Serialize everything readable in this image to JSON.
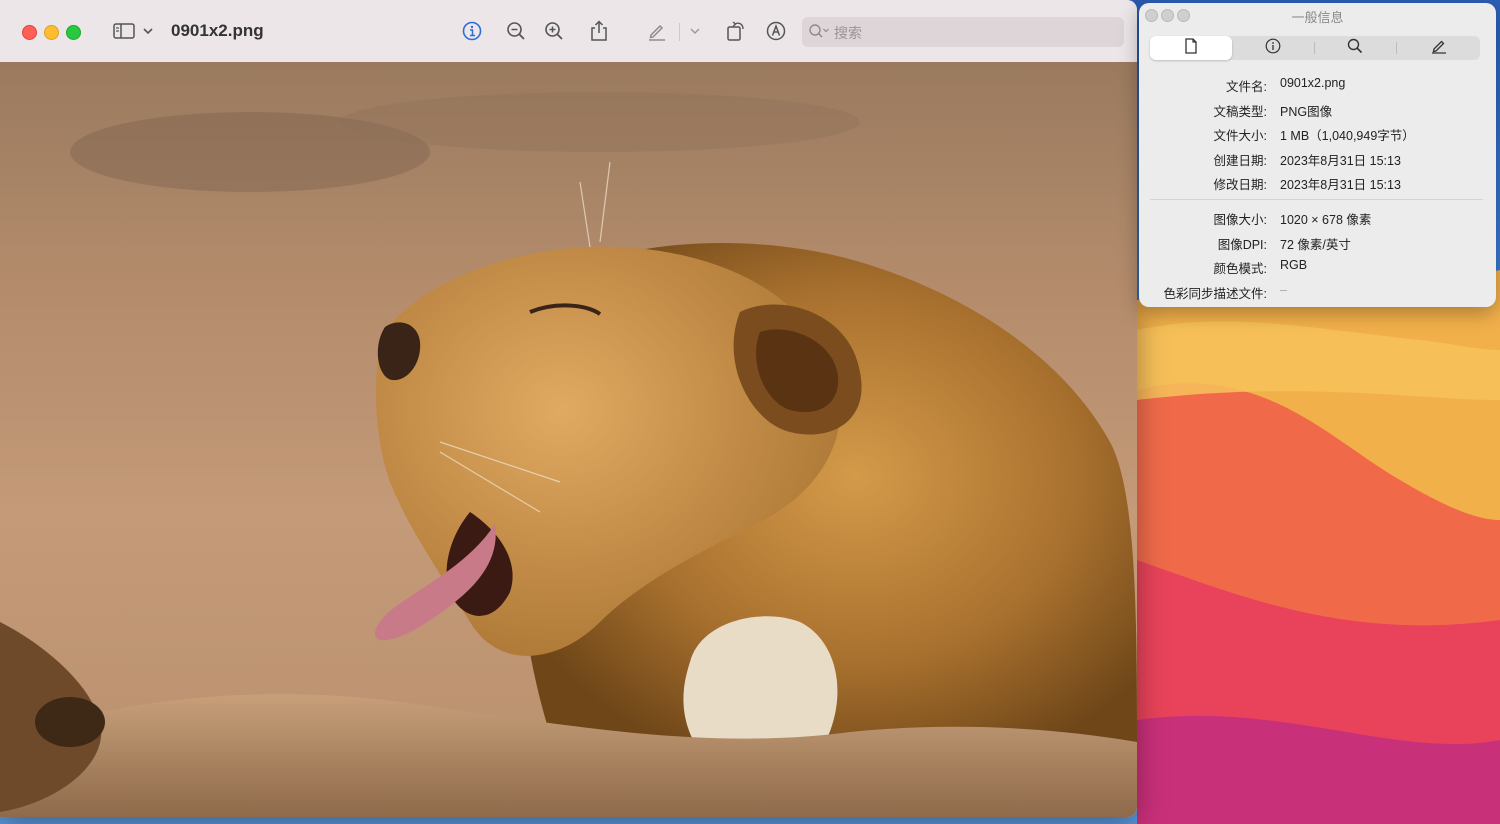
{
  "preview": {
    "document_title": "0901x2.png",
    "search": {
      "placeholder": "搜索",
      "value": ""
    },
    "toolbar_icons": [
      "sidebar-toggle-icon",
      "chevron-down-icon",
      "info-icon",
      "zoom-out-icon",
      "zoom-in-icon",
      "share-icon",
      "markup-pen-icon",
      "chevron-down-icon",
      "rotate-icon",
      "annotate-icon",
      "search-icon"
    ]
  },
  "info_panel": {
    "title": "一般信息",
    "tabs": [
      {
        "name": "document-icon",
        "active": true
      },
      {
        "name": "info-icon",
        "active": false
      },
      {
        "name": "search-icon",
        "active": false
      },
      {
        "name": "pen-icon",
        "active": false
      }
    ],
    "rows": [
      {
        "label": "文件名:",
        "value": "0901x2.png"
      },
      {
        "label": "文稿类型:",
        "value": "PNG图像"
      },
      {
        "label": "文件大小:",
        "value": "1 MB（1,040,949字节）"
      },
      {
        "label": "创建日期:",
        "value": "2023年8月31日 15:13"
      },
      {
        "label": "修改日期:",
        "value": "2023年8月31日 15:13"
      },
      {
        "label": "图像大小:",
        "value": "1020 × 678 像素"
      },
      {
        "label": "图像DPI:",
        "value": "72 像素/英寸"
      },
      {
        "label": "颜色模式:",
        "value": "RGB"
      },
      {
        "label": "色彩同步描述文件:",
        "value": "–"
      }
    ]
  },
  "colors": {
    "traffic_close": "#fe5f57",
    "traffic_minimize": "#febc2e",
    "traffic_maximize": "#28c840",
    "info_accent": "#2d6fd6"
  }
}
